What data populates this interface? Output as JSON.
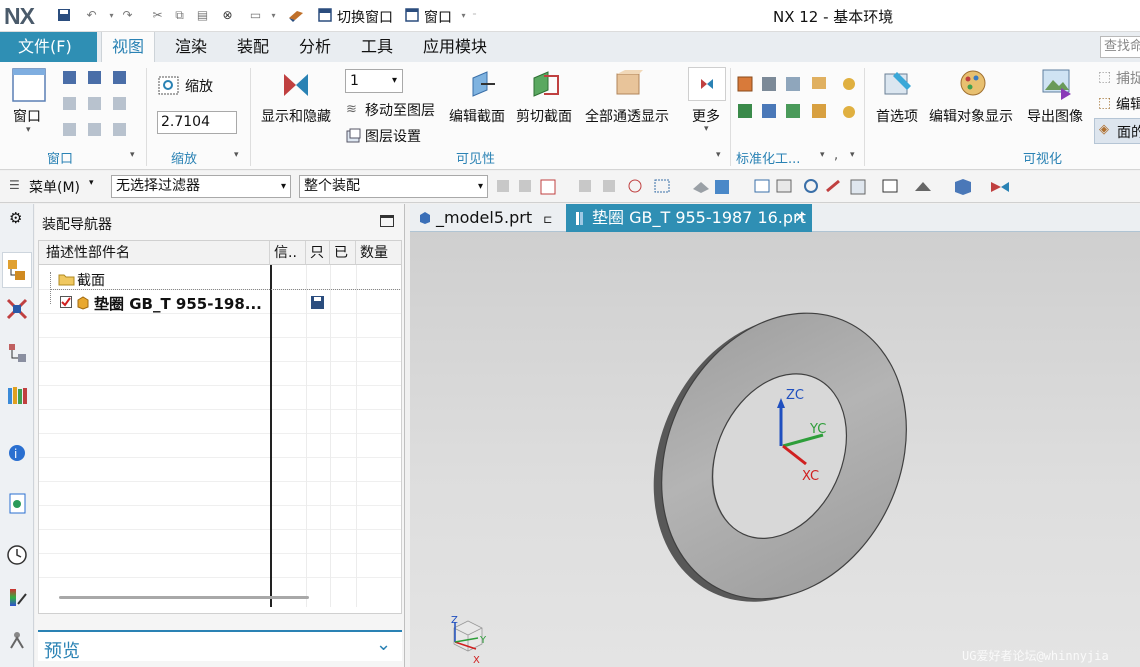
{
  "titlebar": {
    "logo": "NX",
    "quick_switch_window": "切换窗口",
    "quick_window": "窗口",
    "app_title": "NX 12 - 基本环境"
  },
  "menu": {
    "file": "文件(F)",
    "tabs": [
      "视图",
      "渲染",
      "装配",
      "分析",
      "工具",
      "应用模块"
    ],
    "search_placeholder": "查找命"
  },
  "ribbon": {
    "window_group": {
      "label": "窗口",
      "button": "窗口"
    },
    "zoom_group": {
      "label": "缩放",
      "button": "缩放",
      "value": "2.7104"
    },
    "visibility_group": {
      "label": "可见性",
      "show_hide": "显示和隐藏",
      "layer_value": "1",
      "move_to_layer": "移动至图层",
      "layer_settings": "图层设置",
      "edit_section": "编辑截面",
      "clip_section": "剪切截面",
      "all_through": "全部通透显示",
      "more": "更多"
    },
    "standard_group": {
      "label": "标准化工..."
    },
    "visualization_group": {
      "label": "可视化",
      "preferences": "首选项",
      "edit_object_display": "编辑对象显示",
      "export_image": "导出图像",
      "capture": "捕捉",
      "edit": "编辑",
      "face": "面的"
    }
  },
  "toolbar2": {
    "menu_label": "菜单(M)",
    "filter_value": "无选择过滤器",
    "scope_value": "整个装配"
  },
  "navigator": {
    "title": "装配导航器",
    "columns": [
      "描述性部件名",
      "信..",
      "只",
      "已",
      "数量"
    ],
    "rows": [
      {
        "name": "截面"
      },
      {
        "name": "垫圈 GB_T 955-198..."
      }
    ],
    "preview": "预览"
  },
  "doc_tabs": [
    {
      "label": "_model5.prt"
    },
    {
      "label": "垫圈 GB_T 955-1987 16.prt"
    }
  ],
  "viewport": {
    "axes": {
      "z": "ZC",
      "y": "YC",
      "x": "XC"
    },
    "triad": {
      "z": "Z",
      "y": "Y",
      "x": "X"
    }
  },
  "watermark": "UG爱好者论坛@whinnyjia",
  "colors": {
    "accent": "#2f8fb4",
    "label_blue": "#2a82b4",
    "axis_z": "#1f4fbf",
    "axis_y": "#2e9e3a",
    "axis_x": "#d02020"
  }
}
